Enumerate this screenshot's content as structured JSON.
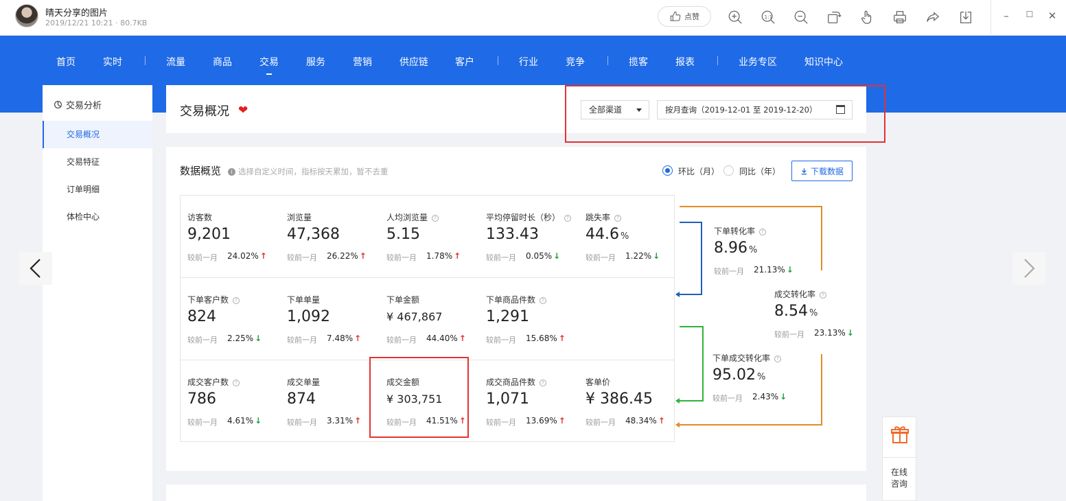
{
  "titlebar": {
    "title": "晴天分享的图片",
    "meta": "2019/12/21 10:21 · 80.7KB",
    "like_label": "点赞",
    "tools": [
      "zoom-in-icon",
      "actual-size-icon",
      "zoom-out-icon",
      "rotate-icon",
      "hand-icon",
      "print-icon",
      "share-icon",
      "download-icon"
    ],
    "window": {
      "minimize": "–",
      "maximize": "☐",
      "close": "✕"
    }
  },
  "nav": {
    "items": [
      "首页",
      "实时",
      "流量",
      "商品",
      "交易",
      "服务",
      "营销",
      "供应链",
      "客户",
      "行业",
      "竞争",
      "揽客",
      "报表",
      "业务专区",
      "知识中心"
    ],
    "active": "交易",
    "color": "#1f6ae6"
  },
  "sidebar": {
    "heading": "交易分析",
    "items": [
      "交易概况",
      "交易特征",
      "订单明细",
      "体检中心"
    ],
    "active": "交易概况"
  },
  "header": {
    "title": "交易概况",
    "channel": "全部渠道",
    "date_range": "按月查询（2019-12-01 至 2019-12-20）"
  },
  "overview": {
    "title": "数据概览",
    "hint": "选择自定义时间，指标按天累加，暂不去重",
    "radio_mom": "环比（月）",
    "radio_yoy": "同比（年）",
    "download": "下载数据",
    "compare_label": "较前一月",
    "rows": [
      [
        {
          "label": "访客数",
          "value": "9,201",
          "pct": "24.02%",
          "dir": "up"
        },
        {
          "label": "浏览量",
          "value": "47,368",
          "pct": "26.22%",
          "dir": "up"
        },
        {
          "label": "人均浏览量",
          "value": "5.15",
          "pct": "1.78%",
          "dir": "up",
          "help": true
        },
        {
          "label": "平均停留时长（秒）",
          "value": "133.43",
          "pct": "0.05%",
          "dir": "down",
          "help": true
        },
        {
          "label": "跳失率",
          "value": "44.6",
          "unit": "%",
          "pct": "1.22%",
          "dir": "down",
          "help": true
        }
      ],
      [
        {
          "label": "下单客户数",
          "value": "824",
          "pct": "2.25%",
          "dir": "down",
          "help": true
        },
        {
          "label": "下单单量",
          "value": "1,092",
          "pct": "7.48%",
          "dir": "up"
        },
        {
          "label": "下单金额",
          "value": "¥ 467,867",
          "pct": "44.40%",
          "dir": "up",
          "small": true
        },
        {
          "label": "下单商品件数",
          "value": "1,291",
          "pct": "15.68%",
          "dir": "up",
          "help": true
        }
      ],
      [
        {
          "label": "成交客户数",
          "value": "786",
          "pct": "4.61%",
          "dir": "down",
          "help": true
        },
        {
          "label": "成交单量",
          "value": "874",
          "pct": "3.31%",
          "dir": "up"
        },
        {
          "label": "成交金额",
          "value": "¥ 303,751",
          "pct": "41.51%",
          "dir": "up",
          "small": true
        },
        {
          "label": "成交商品件数",
          "value": "1,071",
          "pct": "13.69%",
          "dir": "up",
          "help": true
        },
        {
          "label": "客单价",
          "value": "¥ 386.45",
          "pct": "48.34%",
          "dir": "up"
        }
      ]
    ],
    "conversions": [
      {
        "label": "下单转化率",
        "value": "8.96",
        "unit": "%",
        "pct": "21.13%",
        "dir": "down"
      },
      {
        "label": "成交转化率",
        "value": "8.54",
        "unit": "%",
        "pct": "23.13%",
        "dir": "down"
      },
      {
        "label": "下单成交转化率",
        "value": "95.02",
        "unit": "%",
        "pct": "2.43%",
        "dir": "down"
      }
    ],
    "up_arrow": "↑",
    "down_arrow": "↓"
  },
  "float_panel": {
    "consult": "在线咨询"
  },
  "colors": {
    "up": "#e23232",
    "down": "#1f9e3a",
    "accent": "#1f6ae6",
    "highlight_box": "#e23232"
  }
}
